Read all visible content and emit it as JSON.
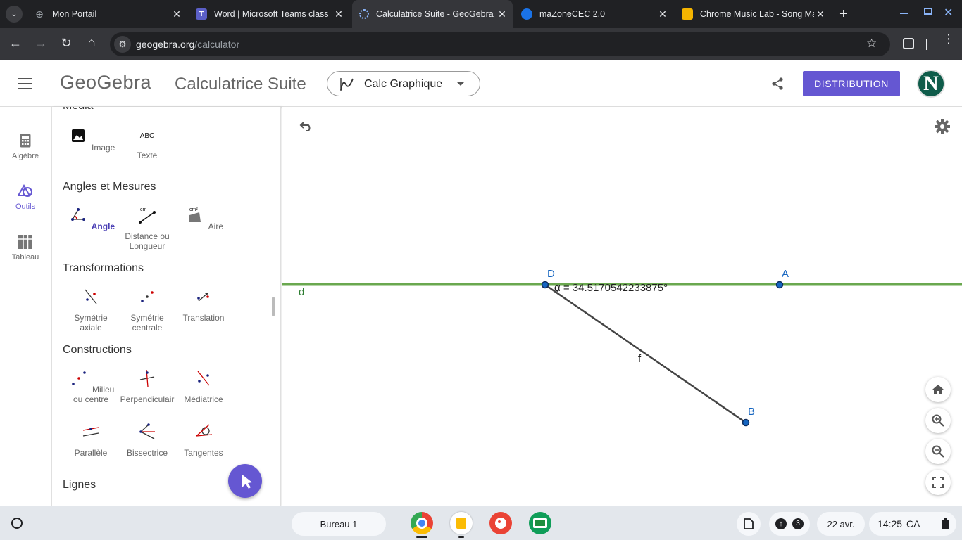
{
  "browser": {
    "tabs": [
      {
        "title": "Mon Portail"
      },
      {
        "title": "Word | Microsoft Teams class"
      },
      {
        "title": "Calculatrice Suite - GeoGebra"
      },
      {
        "title": "maZoneCEC 2.0"
      },
      {
        "title": "Chrome Music Lab - Song Ma"
      }
    ],
    "url_domain": "geogebra.org",
    "url_path": "/calculator"
  },
  "header": {
    "logo": "GeoGebra",
    "app_title": "Calculatrice Suite",
    "app_selector": "Calc Graphique",
    "distribution_button": "DISTRIBUTION",
    "avatar_letter": "N"
  },
  "rail": {
    "items": [
      {
        "label": "Algèbre"
      },
      {
        "label": "Outils"
      },
      {
        "label": "Tableau"
      }
    ]
  },
  "tools": {
    "sections": [
      {
        "title": "Média",
        "tools": [
          {
            "label": "Image"
          },
          {
            "label": "Texte"
          }
        ]
      },
      {
        "title": "Angles et Mesures",
        "tools": [
          {
            "label": "Angle"
          },
          {
            "label": "Distance ou Longueur"
          },
          {
            "label": "Aire"
          }
        ]
      },
      {
        "title": "Transformations",
        "tools": [
          {
            "label": "Symétrie axiale"
          },
          {
            "label": "Symétrie centrale"
          },
          {
            "label": "Translation"
          }
        ]
      },
      {
        "title": "Constructions",
        "tools": [
          {
            "label": "Milieu ou centre"
          },
          {
            "label": "Perpendiculair"
          },
          {
            "label": "Médiatrice"
          },
          {
            "label": "Parallèle"
          },
          {
            "label": "Bissectrice"
          },
          {
            "label": "Tangentes"
          }
        ]
      },
      {
        "title": "Lignes",
        "tools": []
      }
    ],
    "texte_icon_text": "ABC",
    "area_icon_text": "cm²",
    "distance_icon_text": "cm"
  },
  "canvas": {
    "labels": {
      "line_d": "d",
      "point_D": "D",
      "point_A": "A",
      "point_B": "B",
      "segment_f": "f",
      "angle": "α = 34.5170542233875°"
    },
    "line_color": "#6aa84f",
    "point_color": "#1565c0"
  },
  "shelf": {
    "desk": "Bureau 1",
    "date": "22 avr.",
    "time": "14:25",
    "region": "CA",
    "notification_count": "3"
  },
  "colors": {
    "accent": "#6557d2",
    "avatar_bg": "#0f5c4a"
  }
}
